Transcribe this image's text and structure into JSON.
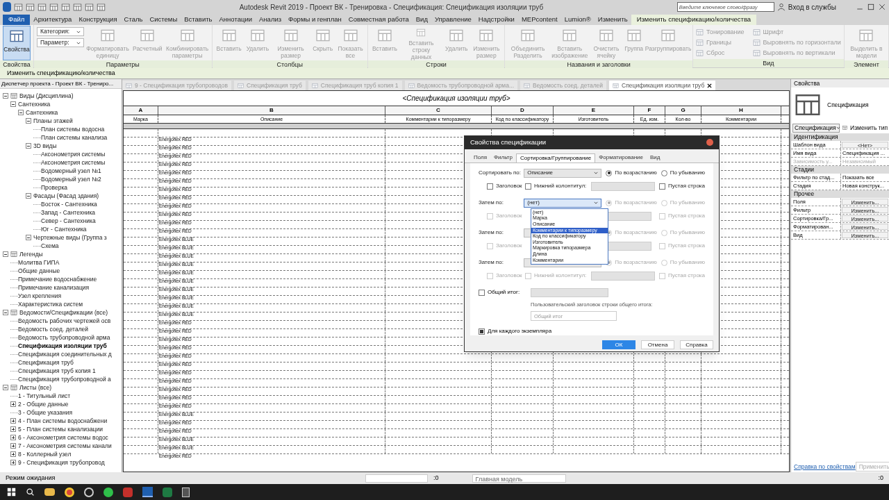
{
  "window": {
    "title": "Autodesk Revit 2019 - Проект ВК - Тренировка - Спецификация: Спецификация изоляции труб",
    "search_placeholder": "Введите ключевое слово/фразу",
    "sign_in": "Вход в службы"
  },
  "menu_tabs": [
    {
      "label": "Файл",
      "kind": "file",
      "selected": false
    },
    {
      "label": "Архитектура",
      "kind": "tab",
      "selected": false
    },
    {
      "label": "Конструкция",
      "kind": "tab",
      "selected": false
    },
    {
      "label": "Сталь",
      "kind": "tab",
      "selected": false
    },
    {
      "label": "Системы",
      "kind": "tab",
      "selected": false
    },
    {
      "label": "Вставить",
      "kind": "tab",
      "selected": false
    },
    {
      "label": "Аннотации",
      "kind": "tab",
      "selected": false
    },
    {
      "label": "Анализ",
      "kind": "tab",
      "selected": false
    },
    {
      "label": "Формы и генплан",
      "kind": "tab",
      "selected": false
    },
    {
      "label": "Совместная работа",
      "kind": "tab",
      "selected": false
    },
    {
      "label": "Вид",
      "kind": "tab",
      "selected": false
    },
    {
      "label": "Управление",
      "kind": "tab",
      "selected": false
    },
    {
      "label": "Надстройки",
      "kind": "tab",
      "selected": false
    },
    {
      "label": "MEPcontent",
      "kind": "tab",
      "selected": false
    },
    {
      "label": "Lumion®",
      "kind": "tab",
      "selected": false
    },
    {
      "label": "Изменить",
      "kind": "tab",
      "selected": false
    },
    {
      "label": "Изменить спецификацию/количества",
      "kind": "tab",
      "selected": true
    }
  ],
  "ribbon": [
    {
      "label": "Свойства",
      "tools": [
        {
          "label": "Свойства",
          "kind": "large",
          "disabled": false,
          "selected": true
        }
      ]
    },
    {
      "label": "Параметры",
      "tools": [
        {
          "label": "Категория:",
          "kind": "combo",
          "disabled": false,
          "selected": false
        },
        {
          "label": "Параметр:",
          "kind": "combo",
          "disabled": false,
          "selected": false
        },
        {
          "label": "Форматировать единицу",
          "kind": "large",
          "disabled": true,
          "selected": false
        },
        {
          "label": "Расчетный",
          "kind": "large",
          "disabled": true,
          "selected": false
        },
        {
          "label": "Комбинировать параметры",
          "kind": "large",
          "disabled": true,
          "selected": false
        }
      ]
    },
    {
      "label": "Столбцы",
      "tools": [
        {
          "label": "Вставить",
          "kind": "large",
          "disabled": true,
          "selected": false
        },
        {
          "label": "Удалить",
          "kind": "large",
          "disabled": true,
          "selected": false
        },
        {
          "label": "Изменить размер",
          "kind": "large",
          "disabled": true,
          "selected": false
        },
        {
          "label": "Скрыть",
          "kind": "large",
          "disabled": true,
          "selected": false
        },
        {
          "label": "Показать все",
          "kind": "large",
          "disabled": true,
          "selected": false
        }
      ]
    },
    {
      "label": "Строки",
      "tools": [
        {
          "label": "Вставить",
          "kind": "large",
          "disabled": true,
          "selected": false
        },
        {
          "label": "Вставить строку данных",
          "kind": "large",
          "disabled": true,
          "selected": false
        },
        {
          "label": "Удалить",
          "kind": "large",
          "disabled": true,
          "selected": false
        },
        {
          "label": "Изменить размер",
          "kind": "large",
          "disabled": true,
          "selected": false
        }
      ]
    },
    {
      "label": "Названия и заголовки",
      "tools": [
        {
          "label": "Объединить Разделить",
          "kind": "large",
          "disabled": true,
          "selected": false
        },
        {
          "label": "Вставить изображение",
          "kind": "large",
          "disabled": true,
          "selected": false
        },
        {
          "label": "Очистить ячейку",
          "kind": "large",
          "disabled": true,
          "selected": false
        },
        {
          "label": "Группа",
          "kind": "large",
          "disabled": true,
          "selected": false
        },
        {
          "label": "Разгруппировать",
          "kind": "large",
          "disabled": true,
          "selected": false
        }
      ]
    },
    {
      "label": "Вид",
      "tools": [
        {
          "label": "Тонирование",
          "kind": "small",
          "disabled": true,
          "selected": false
        },
        {
          "label": "Границы",
          "kind": "small",
          "disabled": true,
          "selected": false
        },
        {
          "label": "Сброс",
          "kind": "small",
          "disabled": true,
          "selected": false
        },
        {
          "label": "Шрифт",
          "kind": "small",
          "disabled": true,
          "selected": false
        },
        {
          "label": "Выровнять  по горизонтали",
          "kind": "small",
          "disabled": true,
          "selected": false
        },
        {
          "label": "Выровнять  по вертикали",
          "kind": "small",
          "disabled": true,
          "selected": false
        }
      ]
    },
    {
      "label": "Элемент",
      "tools": [
        {
          "label": "Выделить в модели",
          "kind": "large",
          "disabled": true,
          "selected": false
        }
      ]
    }
  ],
  "context_bar": "Изменить спецификацию/количества",
  "browser": {
    "title": "Диспетчер проекта - Проект ВК - Трениро...",
    "items": [
      {
        "label": "Виды (Дисциплина)",
        "expanded": true,
        "children": [
          {
            "label": "Сантехника",
            "expanded": true,
            "children": [
              {
                "label": "Сантехника",
                "expanded": true,
                "children": [
                  {
                    "label": "Планы этажей",
                    "expanded": true,
                    "children": [
                      {
                        "label": "План системы водосна"
                      },
                      {
                        "label": "План системы канализа"
                      }
                    ]
                  },
                  {
                    "label": "3D виды",
                    "expanded": true,
                    "children": [
                      {
                        "label": "Аксонометрия системы"
                      },
                      {
                        "label": "Аксонометрия системы"
                      },
                      {
                        "label": "Водомерный узел №1"
                      },
                      {
                        "label": "Водомерный узел №2"
                      },
                      {
                        "label": "Проверка"
                      }
                    ]
                  },
                  {
                    "label": "Фасады (Фасад здания)",
                    "expanded": true,
                    "children": [
                      {
                        "label": "Восток - Сантехника"
                      },
                      {
                        "label": "Запад - Сантехника"
                      },
                      {
                        "label": "Север - Сантехника"
                      },
                      {
                        "label": "Юг - Сантехника"
                      }
                    ]
                  },
                  {
                    "label": "Чертежные виды (Группа з",
                    "expanded": true,
                    "children": [
                      {
                        "label": "Схема"
                      }
                    ]
                  }
                ]
              }
            ]
          }
        ]
      },
      {
        "label": "Легенды",
        "expanded": true,
        "children": [
          {
            "label": "Молитва ГИПА"
          },
          {
            "label": "Общие данные"
          },
          {
            "label": "Примечание водоснабжение"
          },
          {
            "label": "Примечание канализация"
          },
          {
            "label": "Узел крепления"
          },
          {
            "label": "Характеристика систем"
          }
        ]
      },
      {
        "label": "Ведомости/Спецификации (все)",
        "expanded": true,
        "children": [
          {
            "label": "Ведомость рабочих чертежей осв"
          },
          {
            "label": "Ведомость соед. деталей"
          },
          {
            "label": "Ведомость трубопроводной арма"
          },
          {
            "label": "Спецификация изоляции труб",
            "current": true
          },
          {
            "label": "Спецификация соединительных д"
          },
          {
            "label": "Спецификация труб"
          },
          {
            "label": "Спецификация труб копия 1"
          },
          {
            "label": "Спецификация трубопроводной а"
          }
        ]
      },
      {
        "label": "Листы (все)",
        "expanded": true,
        "children": [
          {
            "label": "1 - Титульный лист"
          },
          {
            "label": "2 - Общие данные",
            "expanded": false
          },
          {
            "label": "3 - Общие указания"
          },
          {
            "label": "4 - План системы водоснабжени",
            "expanded": false
          },
          {
            "label": "5 - План системы канализации",
            "expanded": false
          },
          {
            "label": "6 - Аксонометрия системы водос",
            "expanded": false
          },
          {
            "label": "7 - Аксонометрия системы канали",
            "expanded": false
          },
          {
            "label": "8 - Коллерный узел",
            "expanded": false
          },
          {
            "label": "9 - Спецификация трубопровод",
            "expanded": false
          }
        ]
      }
    ]
  },
  "doc_tabs": [
    {
      "label": "9 - Спецификация трубопроводов",
      "selected": false
    },
    {
      "label": "Спецификация труб",
      "selected": false
    },
    {
      "label": "Спецификация труб копия 1",
      "selected": false
    },
    {
      "label": "Ведомость трубопроводной арма...",
      "selected": false
    },
    {
      "label": "Ведомость соед. деталей",
      "selected": false
    },
    {
      "label": "Спецификация изоляции труб",
      "selected": true
    }
  ],
  "schedule": {
    "title": "<Спецификация изоляции труб>",
    "columns": [
      {
        "letter": "A",
        "name": "Марка"
      },
      {
        "letter": "B",
        "name": "Описание"
      },
      {
        "letter": "C",
        "name": "Комментарии к типоразмеру"
      },
      {
        "letter": "D",
        "name": "Код по классификатору"
      },
      {
        "letter": "E",
        "name": "Изготовитель"
      },
      {
        "letter": "F",
        "name": "Ед. изм."
      },
      {
        "letter": "G",
        "name": "Кол-во"
      },
      {
        "letter": "H",
        "name": "Комментарии"
      }
    ],
    "rows": [
      "Energoflex RED",
      "Energoflex RED",
      "Energoflex RED",
      "Energoflex RED",
      "Energoflex RED",
      "Energoflex RED",
      "Energoflex RED",
      "Energoflex RED",
      "Energoflex RED",
      "Energoflex RED",
      "Energoflex RED",
      "Energoflex RED",
      "Energoflex BLUE",
      "Energoflex BLUE",
      "Energoflex BLUE",
      "Energoflex BLUE",
      "Energoflex BLUE",
      "Energoflex BLUE",
      "Energoflex BLUE",
      "Energoflex BLUE",
      "Energoflex BLUE",
      "Energoflex BLUE",
      "Energoflex RED",
      "Energoflex RED",
      "Energoflex RED",
      "Energoflex RED",
      "Energoflex RED",
      "Energoflex RED",
      "Energoflex RED",
      "Energoflex RED",
      "Energoflex RED",
      "Energoflex RED",
      "Energoflex RED",
      "Energoflex BLUE",
      "Energoflex RED",
      "Energoflex RED",
      "Energoflex BLUE",
      "Energoflex BLUE",
      "Energoflex RED"
    ]
  },
  "dialog": {
    "title": "Свойства спецификации",
    "tabs": [
      {
        "label": "Поля",
        "selected": false
      },
      {
        "label": "Фильтр",
        "selected": false
      },
      {
        "label": "Сортировка/Группирование",
        "selected": true
      },
      {
        "label": "Форматирование",
        "selected": false
      },
      {
        "label": "Вид",
        "selected": false
      }
    ],
    "levels": [
      {
        "label": "Сортировать по:",
        "value": "Описание",
        "ascending_label": "По возрастанию",
        "descending_label": "По убыванию",
        "ascending": true,
        "disabled": false,
        "open": false,
        "header_label": "Заголовок",
        "header": false,
        "footer_label": "Нижний колонтитул:",
        "footer": false,
        "blank_label": "Пустая строка",
        "blank": false
      },
      {
        "label": "Затем по:",
        "value": "(нет)",
        "ascending_label": "По возрастанию",
        "descending_label": "По убыванию",
        "ascending": true,
        "disabled": true,
        "open": true,
        "header_label": "Заголовок",
        "header": false,
        "blank_label": "Пустая строка",
        "blank": false
      },
      {
        "label": "Затем по:",
        "ascending_label": "По возрастанию",
        "descending_label": "По убыванию",
        "ascending": true,
        "disabled": true,
        "open": false,
        "header_label": "Заголовок",
        "header": false,
        "blank_label": "Пустая строка",
        "blank": false
      },
      {
        "label": "Затем по:",
        "ascending_label": "По возрастанию",
        "descending_label": "По убыванию",
        "ascending": true,
        "disabled": true,
        "open": false,
        "header_label": "Заголовок",
        "header": false,
        "footer_label": "Нижний колонтитул:",
        "footer": false,
        "blank_label": "Пустая строка",
        "blank": false
      }
    ],
    "dropdown": [
      {
        "label": "(нет)",
        "selected": false
      },
      {
        "label": "Марка",
        "selected": false
      },
      {
        "label": "Описание",
        "selected": false
      },
      {
        "label": "Комментарии к типоразмеру",
        "selected": true
      },
      {
        "label": "Код по классификатору",
        "selected": false
      },
      {
        "label": "Изготовитель",
        "selected": false
      },
      {
        "label": "Маркировка типоразмера",
        "selected": false
      },
      {
        "label": "Длина",
        "selected": false
      },
      {
        "label": "Комментарии",
        "selected": false
      }
    ],
    "grand_total": {
      "label": "Общий итог:",
      "checked": false,
      "custom_label": "Пользовательский заголовок строки общего итога:",
      "placeholder": "Общий итог"
    },
    "per_instance": {
      "label": "Для каждого экземпляра",
      "checked": true
    },
    "buttons": [
      {
        "label": "ОК",
        "kind": "primary"
      },
      {
        "label": "Отмена",
        "kind": "normal"
      },
      {
        "label": "Справка",
        "kind": "normal"
      }
    ]
  },
  "properties": {
    "title": "Свойства",
    "type": "Спецификация",
    "selector": "Спецификация",
    "edit_type": "Изменить тип",
    "sections": [
      {
        "label": "Идентификация",
        "rows": [
          {
            "name": "Шаблон вида",
            "value": "<Нет>",
            "kind": "button",
            "disabled": false
          },
          {
            "name": "Имя вида",
            "value": "Спецификация ...",
            "kind": "text",
            "disabled": false
          },
          {
            "name": "Зависимость у...",
            "value": "Независимый",
            "kind": "text",
            "disabled": true
          }
        ]
      },
      {
        "label": "Стадии",
        "rows": [
          {
            "name": "Фильтр по стад...",
            "value": "Показать все",
            "kind": "text",
            "disabled": false
          },
          {
            "name": "Стадия",
            "value": "Новая конструк...",
            "kind": "text",
            "disabled": false
          }
        ]
      },
      {
        "label": "Прочее",
        "rows": [
          {
            "name": "Поля",
            "value": "Изменить...",
            "kind": "button",
            "disabled": false
          },
          {
            "name": "Фильтр",
            "value": "Изменить...",
            "kind": "button",
            "disabled": false
          },
          {
            "name": "Сортировка/Гр...",
            "value": "Изменить...",
            "kind": "button",
            "disabled": false
          },
          {
            "name": "Форматирован...",
            "value": "Изменить...",
            "kind": "button",
            "disabled": false
          },
          {
            "name": "Вид",
            "value": "Изменить...",
            "kind": "button",
            "disabled": false
          }
        ]
      }
    ],
    "help_link": "Справка по свойствам",
    "apply": "Применить"
  },
  "status_bar": {
    "text": "Режим ожидания",
    "worksets": ":0",
    "model": "Главная модель",
    "filter": ":0"
  }
}
